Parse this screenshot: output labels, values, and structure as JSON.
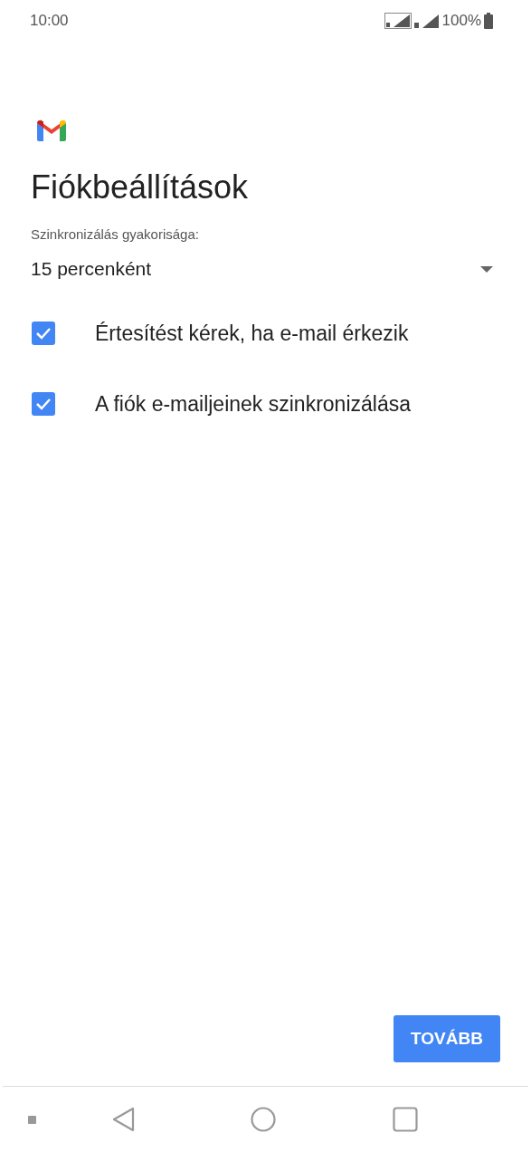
{
  "status_bar": {
    "time": "10:00",
    "battery": "100%"
  },
  "title": "Fiókbeállítások",
  "sync_frequency": {
    "label": "Szinkronizálás gyakorisága:",
    "value": "15 percenként"
  },
  "options": [
    {
      "label": "Értesítést kérek, ha e-mail érkezik",
      "checked": true
    },
    {
      "label": "A fiók e-mailjeinek szinkronizálása",
      "checked": true
    }
  ],
  "next_button": "TOVÁBB"
}
